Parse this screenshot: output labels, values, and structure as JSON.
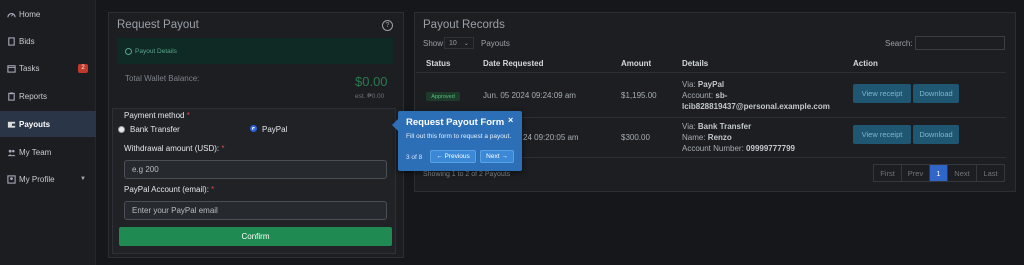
{
  "sidebar": {
    "items": [
      {
        "label": "Home",
        "icon": "gauge-icon"
      },
      {
        "label": "Bids",
        "icon": "document-icon"
      },
      {
        "label": "Tasks",
        "icon": "calendar-icon",
        "badge": "2"
      },
      {
        "label": "Reports",
        "icon": "clipboard-icon"
      },
      {
        "label": "Payouts",
        "icon": "wallet-icon",
        "active": true
      },
      {
        "label": "My Team",
        "icon": "team-icon"
      },
      {
        "label": "My Profile",
        "icon": "profile-icon"
      }
    ]
  },
  "request": {
    "title": "Request Payout",
    "details_label": "Payout Details",
    "balance_label": "Total Wallet Balance:",
    "balance_amount": "$0.00",
    "balance_est": "est. ₱0.00",
    "method_label": "Payment method",
    "method_options": [
      "Bank Transfer",
      "PayPal"
    ],
    "selected_method": "PayPal",
    "amount_label": "Withdrawal amount (USD):",
    "amount_placeholder": "e.g 200",
    "email_label": "PayPal Account (email):",
    "email_placeholder": "Enter your PayPal email",
    "required_mark": "*",
    "confirm": "Confirm"
  },
  "tour": {
    "title": "Request Payout Form",
    "description": "Fill out this form to request a payout.",
    "counter": "3 of 8",
    "previous": "← Previous",
    "next": "Next →",
    "close": "×"
  },
  "records": {
    "title": "Payout Records",
    "show_label": "Show",
    "show_value": "10",
    "payouts_label": "Payouts",
    "search_label": "Search:",
    "columns": [
      "Status",
      "Date Requested",
      "Amount",
      "Details",
      "Action"
    ],
    "rows": [
      {
        "status": "Approved",
        "date": "Jun. 05 2024 09:24:09 am",
        "amount": "$1,195.00",
        "via_label": "Via:",
        "via": "PayPal",
        "line2_label": "Account:",
        "line2": "sb-",
        "line3_label": "",
        "line3": "lcib828819437@personal.example.com",
        "view": "View receipt",
        "download": "Download"
      },
      {
        "status": "",
        "date": "24 09:20:05 am",
        "amount": "$300.00",
        "via_label": "Via:",
        "via": "Bank Transfer",
        "line2_label": "Name:",
        "line2": "Renzo",
        "line3_label": "Account Number:",
        "line3": "09999777799",
        "view": "View receipt",
        "download": "Download"
      }
    ],
    "info": "Showing 1 to 2 of 2 Payouts",
    "pagination": [
      "First",
      "Prev",
      "1",
      "Next",
      "Last"
    ],
    "active_page": "1"
  }
}
